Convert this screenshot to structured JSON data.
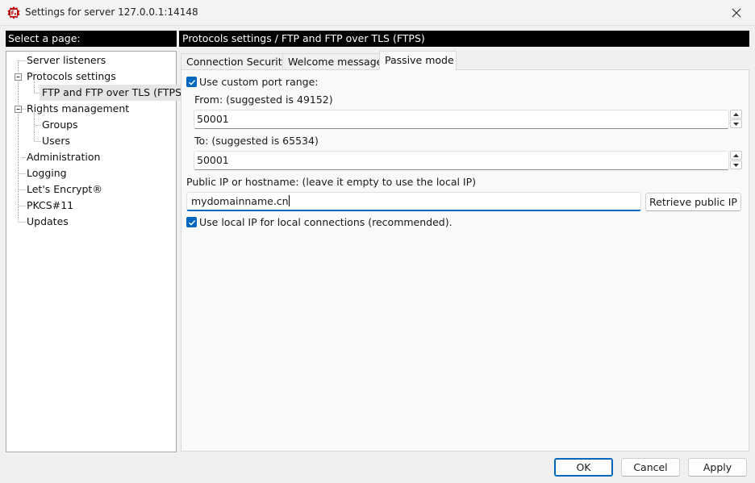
{
  "window": {
    "title": "Settings for server 127.0.0.1:14148"
  },
  "sidebar": {
    "header": "Select a page:",
    "items": [
      {
        "label": "Server listeners"
      },
      {
        "label": "Protocols settings"
      },
      {
        "label": "FTP and FTP over TLS (FTPS)"
      },
      {
        "label": "Rights management"
      },
      {
        "label": "Groups"
      },
      {
        "label": "Users"
      },
      {
        "label": "Administration"
      },
      {
        "label": "Logging"
      },
      {
        "label": "Let's Encrypt®"
      },
      {
        "label": "PKCS#11"
      },
      {
        "label": "Updates"
      }
    ]
  },
  "main": {
    "header": "Protocols settings / FTP and FTP over TLS (FTPS)",
    "tabs": [
      {
        "label": "Connection Security"
      },
      {
        "label": "Welcome message"
      },
      {
        "label": "Passive mode"
      }
    ],
    "active_tab": "Passive mode",
    "passive": {
      "use_custom_range_label": "Use custom port range:",
      "use_custom_range_checked": true,
      "from_label": "From: (suggested is 49152)",
      "from_value": "50001",
      "to_label": "To: (suggested is 65534)",
      "to_value": "50001",
      "public_ip_label": "Public IP or hostname: (leave it empty to use the local IP)",
      "public_ip_value": "mydomainname.cn",
      "retrieve_button": "Retrieve public IP",
      "use_local_ip_label": "Use local IP for local connections (recommended).",
      "use_local_ip_checked": true
    }
  },
  "footer": {
    "ok": "OK",
    "cancel": "Cancel",
    "apply": "Apply"
  },
  "colors": {
    "accent": "#0067c0",
    "header_bg": "#000000",
    "app_icon": "#bf0000"
  }
}
